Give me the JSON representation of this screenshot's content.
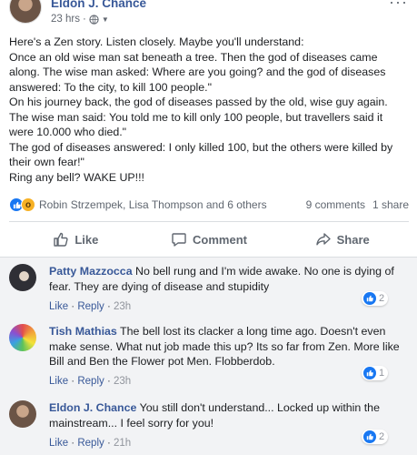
{
  "post": {
    "author": "Eldon J. Chance",
    "time": "23 hrs",
    "separator": "·",
    "more": "···",
    "lines": [
      "Here's a Zen story. Listen closely. Maybe you'll understand:",
      "Once an old wise man sat beneath a tree. Then the god of diseases came",
      "along. The wise man asked: Where are you going? and the god of diseases",
      "answered: To the city, to kill 100 people.\"",
      "On his journey back, the god of diseases passed by the old, wise guy again.",
      "The wise man said: You told me to kill only 100 people, but travellers said it",
      "were 10.000 who died.\"",
      "The god of diseases answered: I only killed 100, but the others were killed by",
      "their own fear!\"",
      "Ring any bell? WAKE UP!!!"
    ],
    "reactors": "Robin Strzempek, Lisa Thompson and 6 others",
    "comments_count": "9 comments",
    "shares_count": "1 share",
    "reaction_icons": [
      "like-icon",
      "wow-icon"
    ]
  },
  "actions": {
    "like": "Like",
    "comment": "Comment",
    "share": "Share"
  },
  "comments": [
    {
      "name": "Patty Mazzocca",
      "lines": [
        " No bell rung and I'm wide awake. No one is dying of",
        "fear. They are dying of disease and stupidity"
      ],
      "like": "Like",
      "reply": "Reply",
      "time": "23h",
      "reactions": "2"
    },
    {
      "name": "Tish Mathias",
      "lines": [
        " The bell lost its clacker a long time ago. Doesn't even",
        "make sense. What nut job made this up? Its so far from Zen. More like",
        "Bill and Ben the Flower pot Men. Flobberdob."
      ],
      "like": "Like",
      "reply": "Reply",
      "time": "23h",
      "reactions": "1"
    },
    {
      "name": "Eldon J. Chance",
      "lines": [
        " You still don't understand... Locked up within the",
        "mainstream... I feel sorry for you!"
      ],
      "like": "Like",
      "reply": "Reply",
      "time": "21h",
      "reactions": "2"
    }
  ],
  "colors": {
    "link": "#385898",
    "like_blue": "#1877f2",
    "muted": "#606770",
    "comments_bg": "#f2f3f5"
  }
}
